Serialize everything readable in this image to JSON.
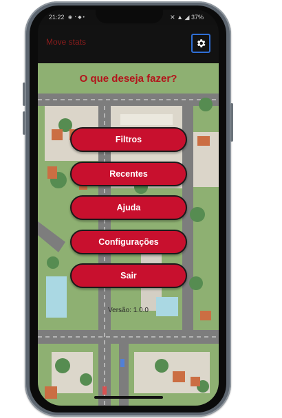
{
  "status_bar": {
    "time": "21:22",
    "left_icons": "◉ ◔ ◆ •",
    "right_icons": "✕ ▲ ◢ 37%"
  },
  "app_bar": {
    "title": "Move stats",
    "settings_icon": "gear-icon"
  },
  "main": {
    "question": "O que deseja fazer?",
    "buttons": [
      {
        "label": "Filtros"
      },
      {
        "label": "Recentes"
      },
      {
        "label": "Ajuda"
      },
      {
        "label": "Configurações"
      },
      {
        "label": "Sair"
      }
    ],
    "version": "Versão: 1.0.0"
  },
  "colors": {
    "accent": "#c8102e",
    "question_text": "#b3141b",
    "app_bar": "#121212",
    "settings_border": "#2f6fd6",
    "map_grass": "#7fa55f",
    "map_road": "#6b6b6b",
    "map_water": "#9fd3e0",
    "map_roof": "#c45a2a"
  }
}
